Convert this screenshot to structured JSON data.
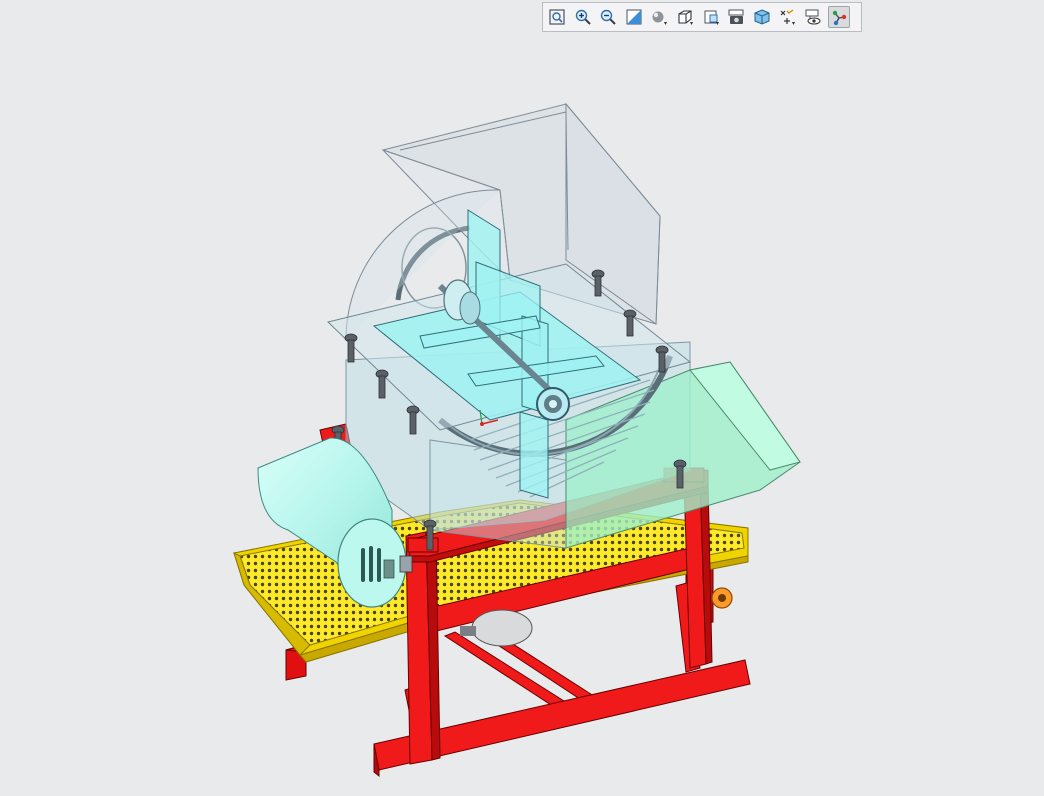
{
  "app": {
    "background": "#e9eaec"
  },
  "toolbar": {
    "buttons": [
      {
        "name": "refit-button",
        "icon": "refit-icon",
        "active": false
      },
      {
        "name": "zoom-in-button",
        "icon": "zoom-in-icon",
        "active": false
      },
      {
        "name": "zoom-out-button",
        "icon": "zoom-out-icon",
        "active": false
      },
      {
        "name": "repaint-button",
        "icon": "repaint-icon",
        "active": false
      },
      {
        "name": "display-style-button",
        "icon": "display-style-icon",
        "active": false
      },
      {
        "name": "saved-orientations-button",
        "icon": "cube-icon",
        "active": false
      },
      {
        "name": "view-manager-button",
        "icon": "view-manager-icon",
        "active": false
      },
      {
        "name": "appearance-button",
        "icon": "camera-icon",
        "active": false
      },
      {
        "name": "perspective-button",
        "icon": "perspective-cube-icon",
        "active": false
      },
      {
        "name": "datum-display-button",
        "icon": "datum-filter-icon",
        "active": false
      },
      {
        "name": "annotation-display-button",
        "icon": "annotation-eye-icon",
        "active": false
      },
      {
        "name": "spin-center-button",
        "icon": "spin-center-icon",
        "active": true
      }
    ]
  },
  "model": {
    "colors": {
      "frame": "#f01a1a",
      "frame_edge": "#6a0000",
      "conveyor": "#ffea2a",
      "conveyor_dark": "#c9a800",
      "housing": "#b8dde4",
      "housing_alpha": 0.45,
      "hopper": "#c9d4dc",
      "motor": "#b6f5ec",
      "chute": "#9ff0cc",
      "plate": "#9ff2f2",
      "drum_rim": "#5a6e78",
      "bolt": "#5b6168",
      "pulley": "#ff9a2a"
    }
  }
}
